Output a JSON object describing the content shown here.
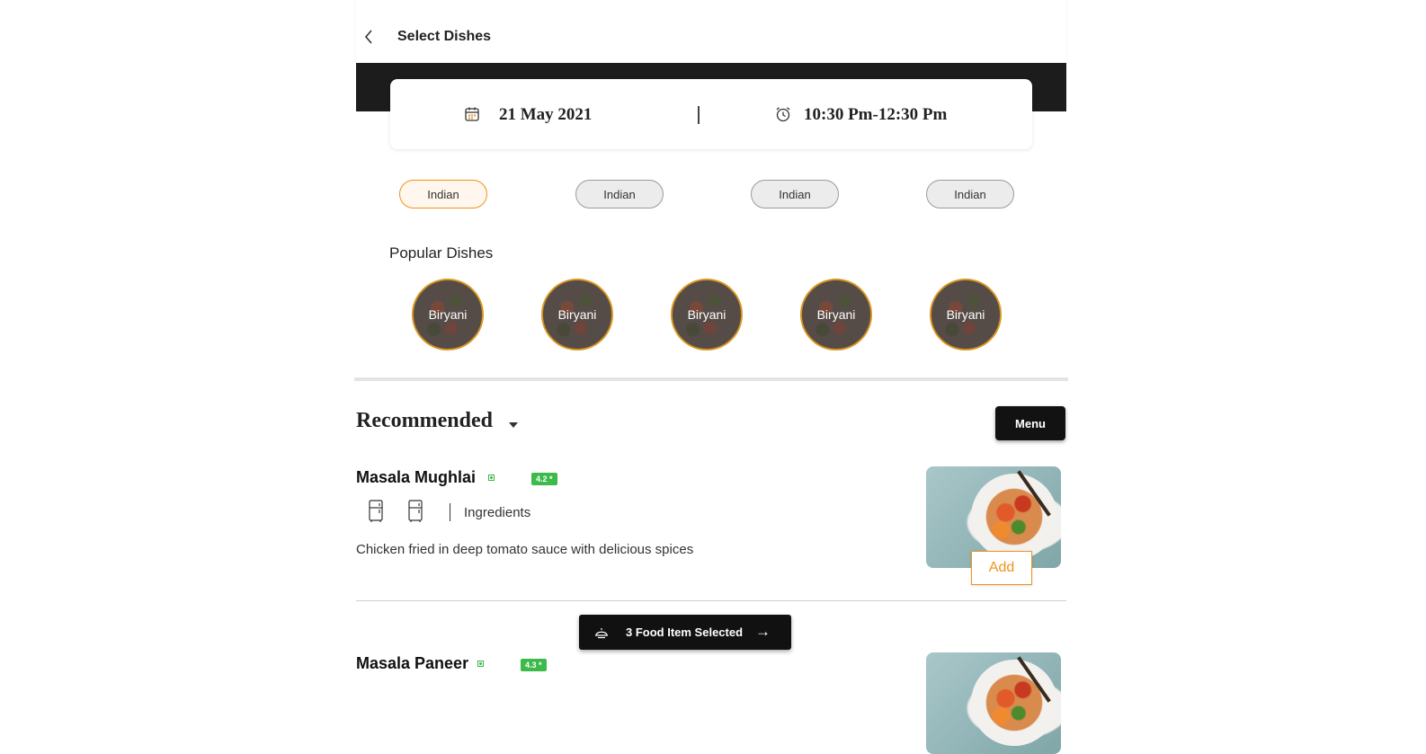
{
  "header": {
    "title": "Select Dishes"
  },
  "schedule": {
    "date": "21 May 2021",
    "time": "10:30 Pm-12:30 Pm"
  },
  "cuisines": [
    {
      "label": "Indian",
      "active": true
    },
    {
      "label": "Indian",
      "active": false
    },
    {
      "label": "Indian",
      "active": false
    },
    {
      "label": "Indian",
      "active": false
    }
  ],
  "popular": {
    "title": "Popular Dishes",
    "dishes": [
      "Biryani",
      "Biryani",
      "Biryani",
      "Biryani",
      "Biryani"
    ]
  },
  "recommended": {
    "title": "Recommended",
    "menu_label": "Menu"
  },
  "items": [
    {
      "name": "Masala Mughlai",
      "rating": "4.2 *",
      "ingredients_label": "Ingredients",
      "description": "Chicken fried in deep tomato sauce with delicious spices",
      "add_label": "Add"
    },
    {
      "name": "Masala Paneer",
      "rating": "4.3 *"
    }
  ],
  "selection": {
    "label": "3 Food Item Selected",
    "arrow": "→"
  },
  "colors": {
    "accent": "#f0931a",
    "rating_green": "#3cbb4b",
    "dark": "#1c1c1c"
  }
}
